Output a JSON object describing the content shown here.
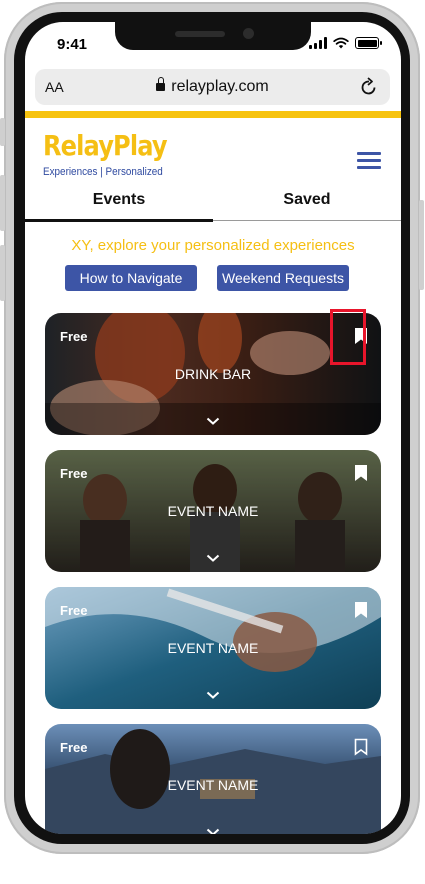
{
  "status_bar": {
    "time": "9:41"
  },
  "browser": {
    "text_size_label": "AA",
    "url": "relayplay.com"
  },
  "header": {
    "logo_title": "RelayPlay",
    "logo_tagline": "Experiences | Personalized"
  },
  "tabs": [
    {
      "label": "Events",
      "active": true
    },
    {
      "label": "Saved",
      "active": false
    }
  ],
  "main": {
    "heading": "XY, explore your personalized experiences",
    "buttons": [
      {
        "label": "How to Navigate"
      },
      {
        "label": "Weekend Requests"
      }
    ]
  },
  "events": [
    {
      "price": "Free",
      "name": "DRINK BAR",
      "saved": true,
      "highlighted": true,
      "icons": [
        "bookmark-filled-icon",
        "chevron-down-icon"
      ]
    },
    {
      "price": "Free",
      "name": "EVENT NAME",
      "saved": true,
      "highlighted": false,
      "icons": [
        "bookmark-filled-icon",
        "chevron-down-icon"
      ]
    },
    {
      "price": "Free",
      "name": "EVENT NAME",
      "saved": true,
      "highlighted": false,
      "icons": [
        "bookmark-filled-icon",
        "chevron-down-icon"
      ]
    },
    {
      "price": "Free",
      "name": "EVENT NAME",
      "saved": false,
      "highlighted": false,
      "icons": [
        "bookmark-outline-icon",
        "chevron-down-icon"
      ]
    }
  ],
  "colors": {
    "brand_yellow": "#f5bf14",
    "brand_blue": "#3d55a6",
    "highlight_red": "#e8152b"
  }
}
